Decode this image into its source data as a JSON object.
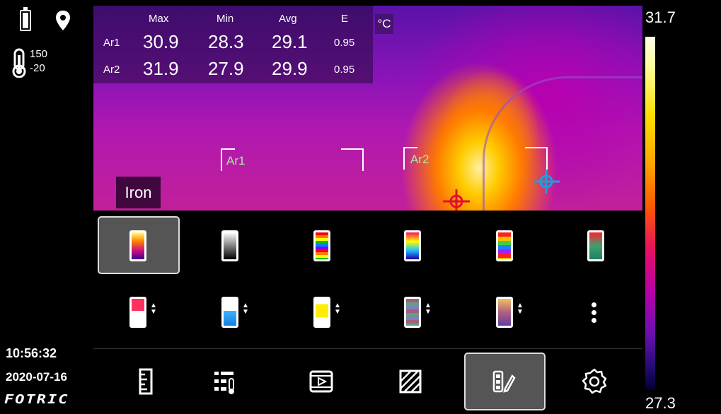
{
  "status": {
    "range_high": "150",
    "range_low": "-20",
    "time": "10:56:32",
    "date": "2020-07-16",
    "brand": "FOTRIC"
  },
  "stats": {
    "headers": [
      "Max",
      "Min",
      "Avg",
      "E"
    ],
    "rows": [
      {
        "label": "Ar1",
        "max": "30.9",
        "min": "28.3",
        "avg": "29.1",
        "e": "0.95"
      },
      {
        "label": "Ar2",
        "max": "31.9",
        "min": "27.9",
        "avg": "29.9",
        "e": "0.95"
      }
    ],
    "unit": "°C"
  },
  "areas": [
    {
      "label": "Ar1"
    },
    {
      "label": "Ar2"
    }
  ],
  "palette": {
    "current_name": "Iron",
    "selected_index": 0,
    "row1": [
      "iron",
      "grayscale",
      "rainbow-high-contrast",
      "rainbow",
      "rainbow-bands",
      "red-green"
    ],
    "row2": [
      "isotherm-red",
      "isotherm-blue",
      "isotherm-yellow",
      "isotherm-bands",
      "isotherm-gradient"
    ]
  },
  "color_scale": {
    "max": "31.7",
    "min": "27.3"
  },
  "toolbar": {
    "items": [
      "ruler-icon",
      "measure-settings-icon",
      "video-icon",
      "area-tool-icon",
      "palette-edit-icon",
      "settings-gear-icon"
    ],
    "selected_index": 4
  },
  "colors": {
    "accent_green": "#9ff09f",
    "crosshair_max": "#e01030",
    "crosshair_min": "#1aa0e0"
  }
}
